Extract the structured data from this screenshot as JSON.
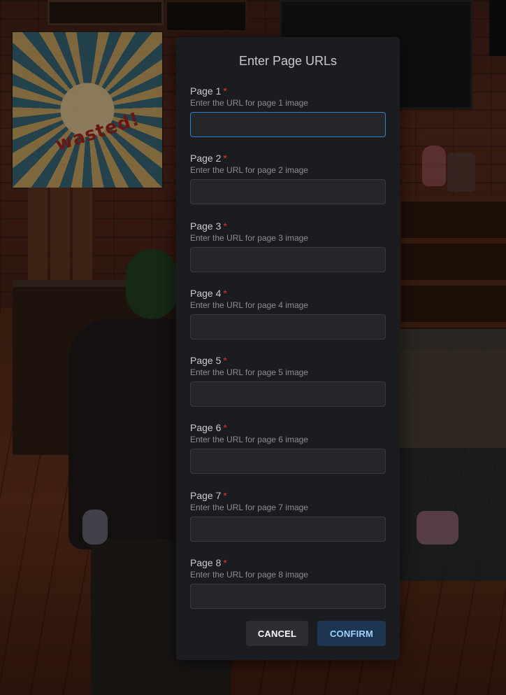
{
  "background": {
    "poster_text": "wasted!"
  },
  "modal": {
    "title": "Enter Page URLs",
    "required_marker": "*",
    "fields": [
      {
        "label": "Page 1",
        "description": "Enter the URL for page 1 image",
        "value": "",
        "focused": true
      },
      {
        "label": "Page 2",
        "description": "Enter the URL for page 2 image",
        "value": ""
      },
      {
        "label": "Page 3",
        "description": "Enter the URL for page 3 image",
        "value": ""
      },
      {
        "label": "Page 4",
        "description": "Enter the URL for page 4 image",
        "value": ""
      },
      {
        "label": "Page 5",
        "description": "Enter the URL for page 5 image",
        "value": ""
      },
      {
        "label": "Page 6",
        "description": "Enter the URL for page 6 image",
        "value": ""
      },
      {
        "label": "Page 7",
        "description": "Enter the URL for page 7 image",
        "value": ""
      },
      {
        "label": "Page 8",
        "description": "Enter the URL for page 8 image",
        "value": ""
      }
    ],
    "cancel_label": "CANCEL",
    "confirm_label": "CONFIRM"
  },
  "colors": {
    "required": "#e03131",
    "focus_border": "#2f7fc8",
    "confirm_text": "#9fd1ff",
    "confirm_bg": "#1c3550",
    "modal_bg": "#1b1c20"
  }
}
